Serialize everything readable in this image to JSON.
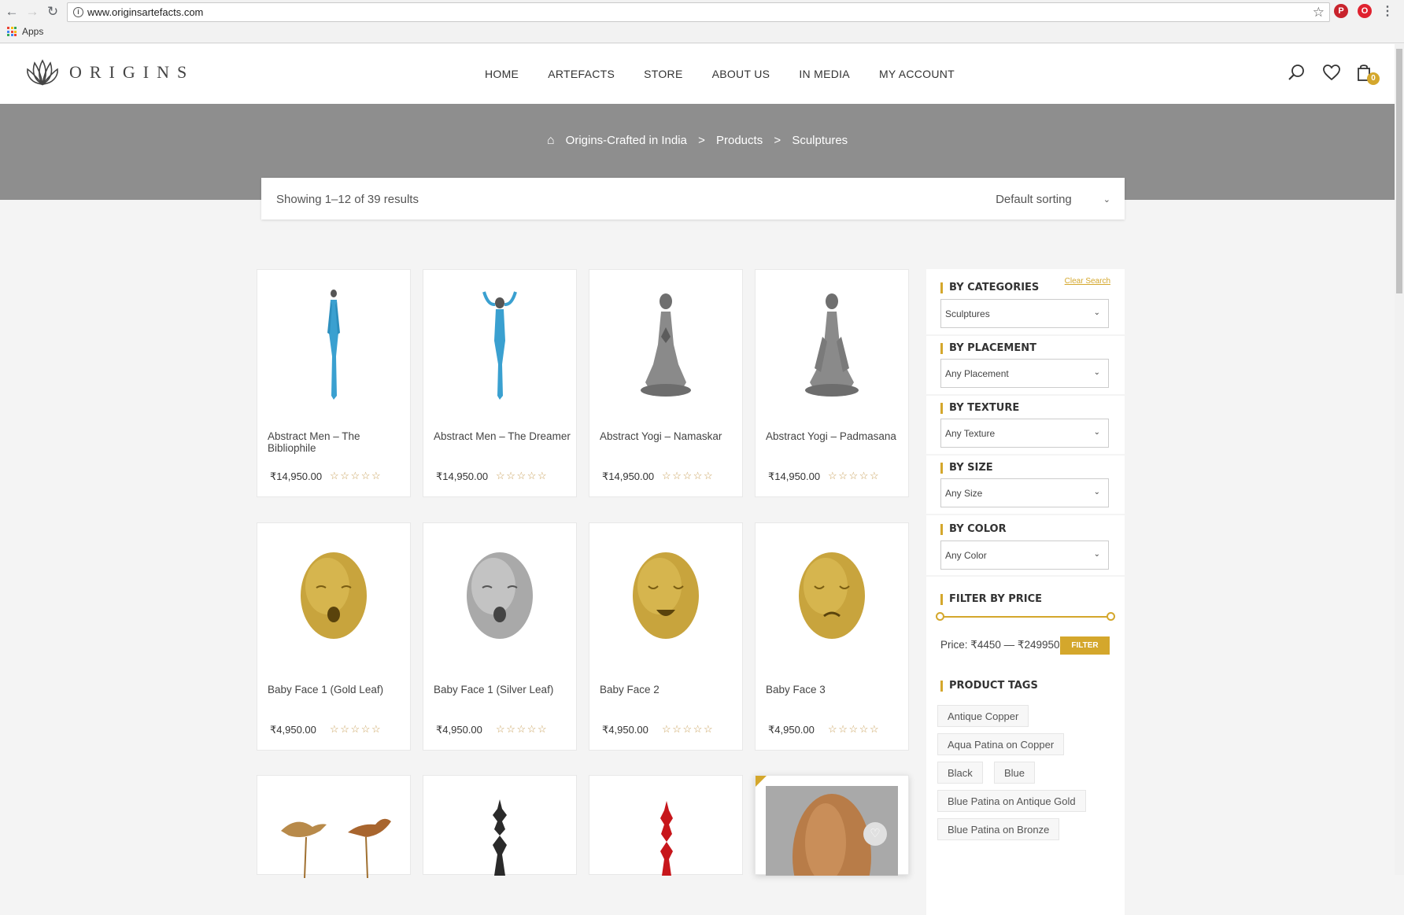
{
  "browser": {
    "url": "www.originsartefacts.com",
    "bookmarks_apps": "Apps",
    "icons": [
      "back-arrow",
      "forward-arrow",
      "reload",
      "info",
      "star",
      "pinterest",
      "opera",
      "menu-dots"
    ]
  },
  "header": {
    "logo_text": "ORIGINS",
    "nav": [
      "HOME",
      "ARTEFACTS",
      "STORE",
      "ABOUT US",
      "IN MEDIA",
      "MY ACCOUNT"
    ],
    "cart_count": "0",
    "icons": [
      "search-icon",
      "heart-icon",
      "bag-icon"
    ]
  },
  "breadcrumb": {
    "home": "Origins-Crafted in India",
    "sep": ">",
    "level2": "Products",
    "level3": "Sculptures"
  },
  "results": {
    "count_text": "Showing 1–12 of 39 results",
    "sort_value": "Default sorting"
  },
  "products": [
    {
      "name": "Abstract Men – The Bibliophile",
      "price": "₹14,950.00",
      "stars": "☆☆☆☆☆"
    },
    {
      "name": "Abstract Men – The Dreamer",
      "price": "₹14,950.00",
      "stars": "☆☆☆☆☆"
    },
    {
      "name": "Abstract Yogi – Namaskar",
      "price": "₹14,950.00",
      "stars": "☆☆☆☆☆"
    },
    {
      "name": "Abstract Yogi – Padmasana",
      "price": "₹14,950.00",
      "stars": "☆☆☆☆☆"
    },
    {
      "name": "Baby Face 1 (Gold Leaf)",
      "price": "₹4,950.00",
      "stars": "☆☆☆☆☆"
    },
    {
      "name": "Baby Face 1 (Silver Leaf)",
      "price": "₹4,950.00",
      "stars": "☆☆☆☆☆"
    },
    {
      "name": "Baby Face 2",
      "price": "₹4,950.00",
      "stars": "☆☆☆☆☆"
    },
    {
      "name": "Baby Face 3",
      "price": "₹4,950.00",
      "stars": "☆☆☆☆☆"
    }
  ],
  "sidebar": {
    "categories": {
      "title": "BY CATEGORIES",
      "value": "Sculptures",
      "clear": "Clear Search"
    },
    "placement": {
      "title": "BY PLACEMENT",
      "value": "Any Placement"
    },
    "texture": {
      "title": "BY TEXTURE",
      "value": "Any Texture"
    },
    "size": {
      "title": "BY SIZE",
      "value": "Any Size"
    },
    "color": {
      "title": "BY COLOR",
      "value": "Any Color"
    },
    "price": {
      "title": "FILTER BY PRICE",
      "label": "Price: ₹4450 — ₹249950",
      "button": "FILTER",
      "range": [
        4450,
        249950
      ],
      "selected": [
        4450,
        249950
      ]
    },
    "tags": {
      "title": "PRODUCT TAGS",
      "items": [
        "Antique Copper",
        "Aqua Patina on Copper",
        "Black",
        "Blue",
        "Blue Patina on Antique Gold",
        "Blue Patina on Bronze"
      ]
    }
  },
  "colors": {
    "accent": "#d4a72c",
    "hero": "#8e8e8e"
  }
}
